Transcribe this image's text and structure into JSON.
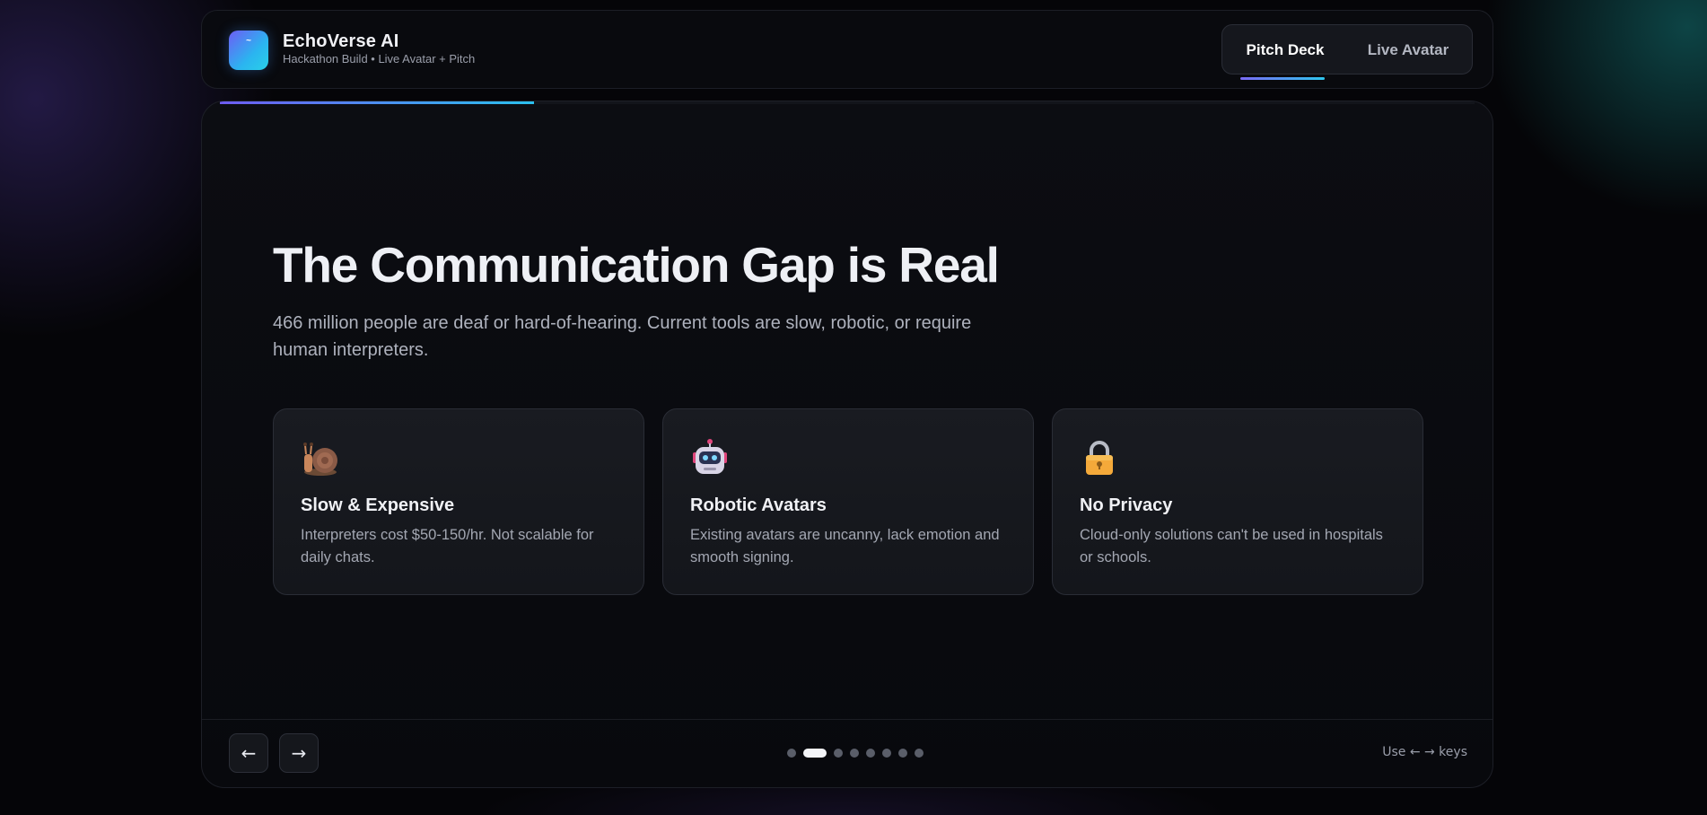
{
  "header": {
    "logo_icon": "echo-wave-icon",
    "logo_glyph": "~",
    "title": "EchoVerse AI",
    "subtitle": "Hackathon Build • Live Avatar + Pitch",
    "tabs": [
      {
        "label": "Pitch Deck",
        "active": true
      },
      {
        "label": "Live Avatar",
        "active": false
      }
    ]
  },
  "slide": {
    "progress": 0.25,
    "title": "The Communication Gap is Real",
    "subtitle": "466 million people are deaf or hard-of-hearing. Current tools are slow, robotic, or require human interpreters.",
    "cards": [
      {
        "icon": "snail-icon",
        "title": "Slow & Expensive",
        "description": "Interpreters cost $50-150/hr. Not scalable for daily chats."
      },
      {
        "icon": "robot-icon",
        "title": "Robotic Avatars",
        "description": "Existing avatars are uncanny, lack emotion and smooth signing."
      },
      {
        "icon": "lock-icon",
        "title": "No Privacy",
        "description": "Cloud-only solutions can't be used in hospitals or schools."
      }
    ]
  },
  "footer": {
    "prev_label": "←",
    "next_label": "→",
    "slide_count": 8,
    "current_slide": 2,
    "key_hint": "Use ← → keys"
  },
  "colors": {
    "accent_start": "#6e5cf2",
    "accent_end": "#2bc0ee",
    "background": "#050508",
    "card_bg": "#191b21"
  }
}
